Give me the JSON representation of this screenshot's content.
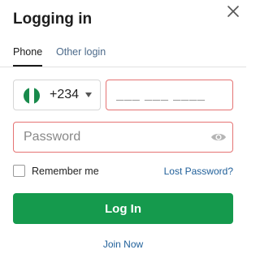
{
  "header": {
    "title": "Logging in"
  },
  "tabs": [
    {
      "label": "Phone",
      "active": true
    },
    {
      "label": "Other login",
      "active": false
    }
  ],
  "phone": {
    "country_code": "+234",
    "flag": "nigeria-flag",
    "placeholder": "___ ___ ____"
  },
  "password": {
    "placeholder": "Password"
  },
  "remember": {
    "label": "Remember me",
    "checked": false
  },
  "links": {
    "lost_password": "Lost Password?",
    "join": "Join Now"
  },
  "buttons": {
    "login": "Log In"
  },
  "colors": {
    "primary": "#159a4d",
    "link": "#1f5f99",
    "error_border": "#e57373"
  }
}
